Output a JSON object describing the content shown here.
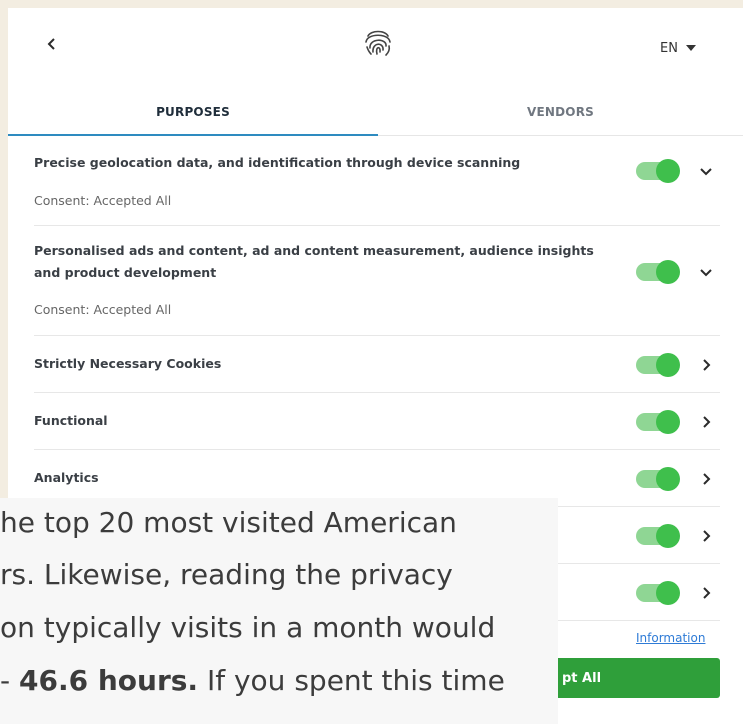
{
  "header": {
    "back_icon": "chevron-left-icon",
    "logo_icon": "fingerprint-icon",
    "language": "EN",
    "language_icon": "caret-down-icon"
  },
  "tabs": [
    {
      "label": "PURPOSES",
      "active": true
    },
    {
      "label": "VENDORS",
      "active": false
    }
  ],
  "accent_color": "#2e8bc0",
  "toggle_color": "#3fbf4c",
  "purposes": [
    {
      "title": "Precise geolocation data, and identification through device scanning",
      "status": "Consent: Accepted All",
      "enabled": true,
      "icon": "chevron-down-icon"
    },
    {
      "title": "Personalised ads and content, ad and content measurement, audience insights and product development",
      "status": "Consent: Accepted All",
      "enabled": true,
      "icon": "chevron-down-icon"
    },
    {
      "title": "Strictly Necessary Cookies",
      "enabled": true,
      "icon": "chevron-right-icon"
    },
    {
      "title": "Functional",
      "enabled": true,
      "icon": "chevron-right-icon"
    },
    {
      "title": "Analytics",
      "enabled": true,
      "icon": "chevron-right-icon"
    },
    {
      "title": "",
      "enabled": true,
      "icon": "chevron-right-icon"
    },
    {
      "title": "",
      "enabled": true,
      "icon": "chevron-right-icon"
    }
  ],
  "footer": {
    "information_link": "Information",
    "accept_button": "pt All"
  },
  "article_overlay": {
    "line1": "he top 20 most visited American",
    "line2": "rs. Likewise, reading the privacy",
    "line3": "on typically visits in a month would",
    "line4_prefix": "- ",
    "line4_bold": "46.6 hours.",
    "line4_suffix": " If you spent this time"
  }
}
